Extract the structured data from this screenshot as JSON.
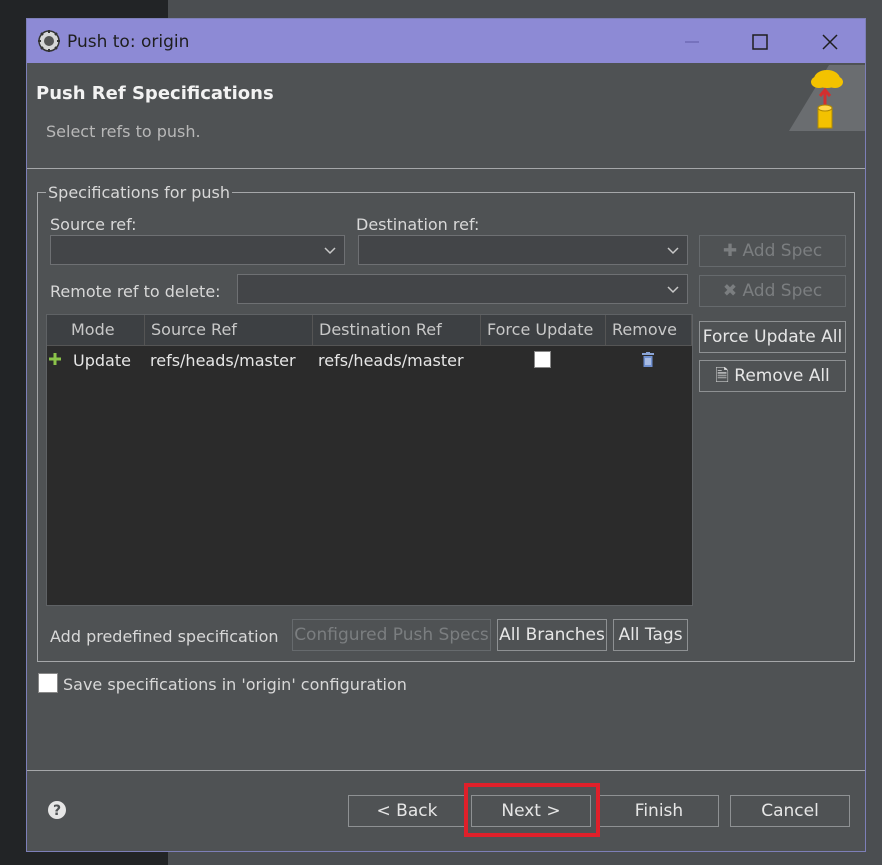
{
  "window": {
    "title": "Push to: origin",
    "app_icon": "eclipse-gear-icon",
    "controls": [
      "minimize-icon",
      "maximize-icon",
      "close-icon"
    ]
  },
  "header": {
    "title": "Push Ref Specifications",
    "subtitle": "Select refs to push.",
    "image": "push-cloud-icon"
  },
  "specs": {
    "legend": "Specifications for push",
    "source_ref_label": "Source ref:",
    "source_ref_value": "",
    "destination_ref_label": "Destination ref:",
    "destination_ref_value": "",
    "remote_delete_label": "Remote ref to delete:",
    "remote_delete_value": "",
    "add_spec_label": "Add Spec",
    "add_spec_remove_label": "Add Spec",
    "force_update_all_label": "Force Update All",
    "remove_all_label": "Remove All",
    "table": {
      "columns": [
        "Mode",
        "Source Ref",
        "Destination Ref",
        "Force Update",
        "Remove"
      ],
      "rows": [
        {
          "mode": "Update",
          "mode_icon": "plus-icon",
          "source": "refs/heads/master",
          "destination": "refs/heads/master",
          "force_update": false,
          "remove_icon": "trash-icon"
        }
      ]
    },
    "predefined_label": "Add predefined specification",
    "configured_push_specs_label": "Configured Push Specs",
    "all_branches_label": "All Branches",
    "all_tags_label": "All Tags"
  },
  "save_config": {
    "label": "Save specifications in 'origin' configuration",
    "checked": false
  },
  "footer": {
    "back_label": "< Back",
    "next_label": "Next >",
    "finish_label": "Finish",
    "cancel_label": "Cancel",
    "help_icon": "help-icon"
  },
  "colors": {
    "titlebar": "#8d8ad5",
    "dialog_bg": "#4f5254",
    "table_bg": "#2b2b2b",
    "highlight": "#e0202a",
    "plus_green": "#8bc34a"
  }
}
